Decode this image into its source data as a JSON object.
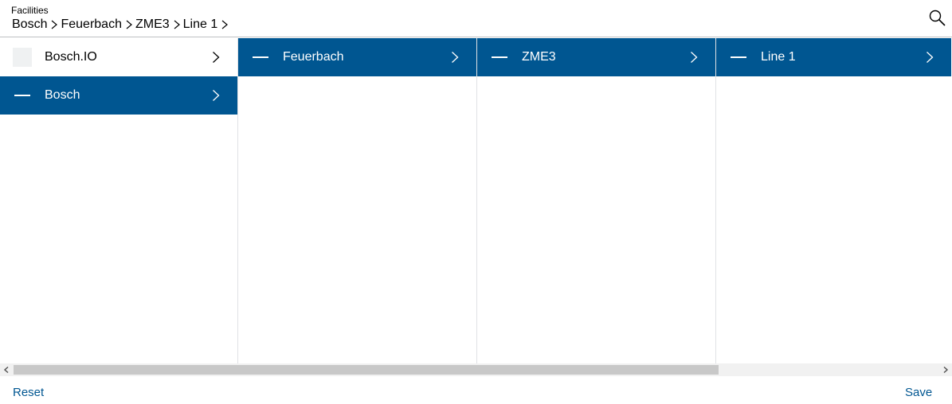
{
  "header": {
    "title": "Facilities",
    "breadcrumb": [
      "Bosch",
      "Feuerbach",
      "ZME3",
      "Line 1"
    ],
    "search_icon": "search-icon"
  },
  "columns": [
    {
      "rows": [
        {
          "label": "Bosch.IO",
          "selected": false,
          "lead": "checkbox"
        },
        {
          "label": "Bosch",
          "selected": true,
          "lead": "dash"
        }
      ]
    },
    {
      "rows": [
        {
          "label": "Feuerbach",
          "selected": true,
          "lead": "dash"
        }
      ]
    },
    {
      "rows": [
        {
          "label": "ZME3",
          "selected": true,
          "lead": "dash"
        }
      ]
    },
    {
      "rows": [
        {
          "label": "Line 1",
          "selected": true,
          "lead": "dash"
        }
      ]
    }
  ],
  "footer": {
    "reset_label": "Reset",
    "save_label": "Save"
  },
  "colors": {
    "accent": "#005691",
    "divider": "#e0e2e5",
    "checkbox_bg": "#eff1f2"
  }
}
